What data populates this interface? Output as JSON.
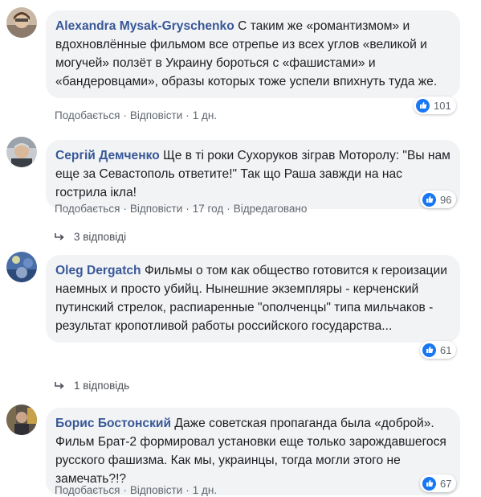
{
  "comments": [
    {
      "author": "Alexandra Mysak-Gryschenko",
      "text": "С таким же «романтизмом» и вдохновлённые фильмом все отрепье из всех углов «великой и могучей» ползёт в Украину бороться с «фашистами» и «бандеровцами», образы которых тоже успели впихнуть туда же.",
      "likes": "101",
      "like_label": "Подобається",
      "reply_label": "Відповісти",
      "time": "1 дн.",
      "edited": ""
    },
    {
      "author": "Сергій Демченко",
      "text": "Ще в ті роки Сухоруков зіграв Моторолу: \"Вы нам еще за Севастополь ответите!\" Так що Раша завжди на нас гострила ікла!",
      "likes": "96",
      "like_label": "Подобається",
      "reply_label": "Відповісти",
      "time": "17 год",
      "edited": "Відредаговано",
      "replies_label": "3 відповіді"
    },
    {
      "author": "Oleg Dergatch",
      "text": "Фильмы о том как общество готовится к героизации наемных и просто убийц. Нынешние экземпляры - керченский путинский стрелок, распиаренные \"ополченцы\" типа мильчаков - результат кропотливой работы российского государства...",
      "likes": "61",
      "replies_label": "1 відповідь"
    },
    {
      "author": "Борис Бостонский",
      "text": "Даже советская пропаганда была «доброй». Фильм Брат-2 формировал установки еще только зарождавшегося русского фашизма. Как мы, украинцы, тогда могли этого не замечать?!?",
      "likes": "67",
      "like_label": "Подобається",
      "reply_label": "Відповісти",
      "time": "1 дн."
    }
  ],
  "colors": {
    "author": "#385898",
    "bubble": "#f2f3f5",
    "meta": "#606770",
    "like_icon": "#1877f2"
  },
  "icons": {
    "like": "thumbs-up-icon",
    "reply_arrow": "reply-arrow-icon"
  }
}
